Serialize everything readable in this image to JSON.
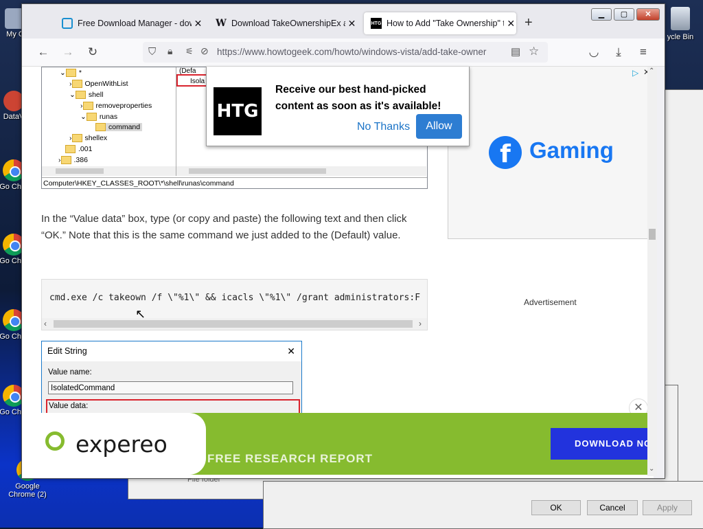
{
  "desktop": {
    "icons": [
      {
        "label": "My C"
      },
      {
        "label": "DataV"
      },
      {
        "label": "Go Chro"
      },
      {
        "label": "Go Chro"
      },
      {
        "label": "Go Chro"
      },
      {
        "label": "Go Chro"
      },
      {
        "label": "Google Chrome (2)"
      }
    ],
    "recycle_label": "ycle Bin"
  },
  "background_dialog": {
    "ok": "OK",
    "cancel": "Cancel",
    "apply": "Apply",
    "file_folder": "File folder"
  },
  "browser": {
    "tabs": [
      {
        "label": "Free Download Manager - down",
        "favicon": "fdm-icon"
      },
      {
        "label": "Download TakeOwnershipEx all",
        "favicon": "W"
      },
      {
        "label": "How to Add \"Take Ownership\" t",
        "favicon": "HTG",
        "active": true
      }
    ],
    "url": "https://www.howtogeek.com/howto/windows-vista/add-take-owner"
  },
  "article": {
    "registry": {
      "tree": [
        "*",
        "OpenWithList",
        "shell",
        "removeproperties",
        "runas",
        "command",
        "shellex",
        ".001",
        ".386"
      ],
      "value_fragment_1": "(Defa",
      "value_fragment_2": "Isola",
      "path": "Computer\\HKEY_CLASSES_ROOT\\*\\shell\\runas\\command"
    },
    "paragraph": "In the “Value data” box, type (or copy and paste) the following text and then click “OK.” Note that this is the same command we just added to the (Default) value.",
    "code": "cmd.exe /c takeown /f \\\"%1\\\" && icacls \\\"%1\\\" /grant administrators:F",
    "edit_string": {
      "title": "Edit String",
      "value_name_label": "Value name:",
      "value_name": "IsolatedCommand",
      "value_data_label": "Value data:"
    }
  },
  "popup": {
    "logo": "HTG",
    "message": "Receive our best hand-picked content as soon as it's available!",
    "no_thanks": "No Thanks",
    "allow": "Allow"
  },
  "ad": {
    "brand": "Gaming",
    "fb_letter": "f",
    "label": "Advertisement"
  },
  "banner": {
    "logo": "expereo",
    "tagline": "FREE RESEARCH REPORT",
    "cta": "DOWNLOAD NO"
  },
  "colors": {
    "accent_blue": "#2d7dd2",
    "facebook_blue": "#1877f2",
    "banner_green": "#86bb2f",
    "banner_cta": "#2233dd",
    "registry_highlight": "#d9232d"
  }
}
